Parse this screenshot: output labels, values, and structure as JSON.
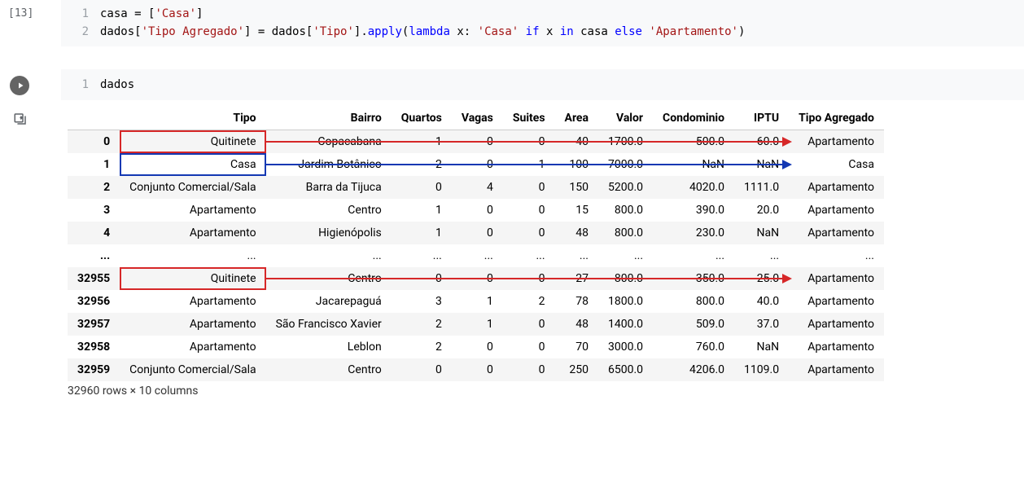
{
  "cells": {
    "c1": {
      "exec_count": "[13]",
      "lines": [
        {
          "n": "1",
          "tokens": [
            "casa = [",
            "'Casa'",
            "]"
          ]
        },
        {
          "n": "2",
          "tokens": [
            "dados[",
            "'Tipo Agregado'",
            "] = dados[",
            "'Tipo'",
            "].",
            "apply",
            "(",
            "lambda",
            " x: ",
            "'Casa'",
            " ",
            "if",
            " x ",
            "in",
            " casa ",
            "else",
            " ",
            "'Apartamento'",
            ")"
          ]
        }
      ]
    },
    "c2": {
      "lines": [
        {
          "n": "1",
          "tokens": [
            "dados"
          ]
        }
      ]
    }
  },
  "table": {
    "columns": [
      "Tipo",
      "Bairro",
      "Quartos",
      "Vagas",
      "Suites",
      "Area",
      "Valor",
      "Condominio",
      "IPTU",
      "Tipo Agregado"
    ],
    "rows": [
      {
        "idx": "0",
        "vals": [
          "Quitinete",
          "Copacabana",
          "1",
          "0",
          "0",
          "40",
          "1700.0",
          "500.0",
          "60.0",
          "Apartamento"
        ],
        "hl": "red"
      },
      {
        "idx": "1",
        "vals": [
          "Casa",
          "Jardim Botânico",
          "2",
          "0",
          "1",
          "100",
          "7000.0",
          "NaN",
          "NaN",
          "Casa"
        ],
        "hl": "blue"
      },
      {
        "idx": "2",
        "vals": [
          "Conjunto Comercial/Sala",
          "Barra da Tijuca",
          "0",
          "4",
          "0",
          "150",
          "5200.0",
          "4020.0",
          "1111.0",
          "Apartamento"
        ]
      },
      {
        "idx": "3",
        "vals": [
          "Apartamento",
          "Centro",
          "1",
          "0",
          "0",
          "15",
          "800.0",
          "390.0",
          "20.0",
          "Apartamento"
        ]
      },
      {
        "idx": "4",
        "vals": [
          "Apartamento",
          "Higienópolis",
          "1",
          "0",
          "0",
          "48",
          "800.0",
          "230.0",
          "NaN",
          "Apartamento"
        ]
      },
      {
        "idx": "...",
        "vals": [
          "...",
          "...",
          "...",
          "...",
          "...",
          "...",
          "...",
          "...",
          "...",
          "..."
        ]
      },
      {
        "idx": "32955",
        "vals": [
          "Quitinete",
          "Centro",
          "0",
          "0",
          "0",
          "27",
          "800.0",
          "350.0",
          "25.0",
          "Apartamento"
        ],
        "hl": "red"
      },
      {
        "idx": "32956",
        "vals": [
          "Apartamento",
          "Jacarepaguá",
          "3",
          "1",
          "2",
          "78",
          "1800.0",
          "800.0",
          "40.0",
          "Apartamento"
        ]
      },
      {
        "idx": "32957",
        "vals": [
          "Apartamento",
          "São Francisco Xavier",
          "2",
          "1",
          "0",
          "48",
          "1400.0",
          "509.0",
          "37.0",
          "Apartamento"
        ]
      },
      {
        "idx": "32958",
        "vals": [
          "Apartamento",
          "Leblon",
          "2",
          "0",
          "0",
          "70",
          "3000.0",
          "760.0",
          "NaN",
          "Apartamento"
        ]
      },
      {
        "idx": "32959",
        "vals": [
          "Conjunto Comercial/Sala",
          "Centro",
          "0",
          "0",
          "0",
          "250",
          "6500.0",
          "4206.0",
          "1109.0",
          "Apartamento"
        ]
      }
    ],
    "footer": "32960 rows × 10 columns"
  }
}
